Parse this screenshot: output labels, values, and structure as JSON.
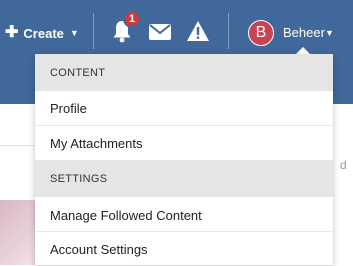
{
  "header": {
    "create_label": "Create",
    "notification_count": "1",
    "user": {
      "initial": "B",
      "name": "Beheer"
    }
  },
  "menu": {
    "sections": [
      {
        "title": "CONTENT",
        "items": [
          "Profile",
          "My Attachments"
        ]
      },
      {
        "title": "SETTINGS",
        "items": [
          "Manage Followed Content",
          "Account Settings"
        ]
      }
    ]
  },
  "page": {
    "partial_right_text": "d"
  },
  "colors": {
    "topbar": "#41689a",
    "badge": "#d1383c",
    "avatar": "#c94452",
    "section_bg": "#e5e5e5"
  },
  "icons": [
    "plus-icon",
    "caret-down-icon",
    "bell-icon",
    "envelope-icon",
    "warning-icon"
  ]
}
